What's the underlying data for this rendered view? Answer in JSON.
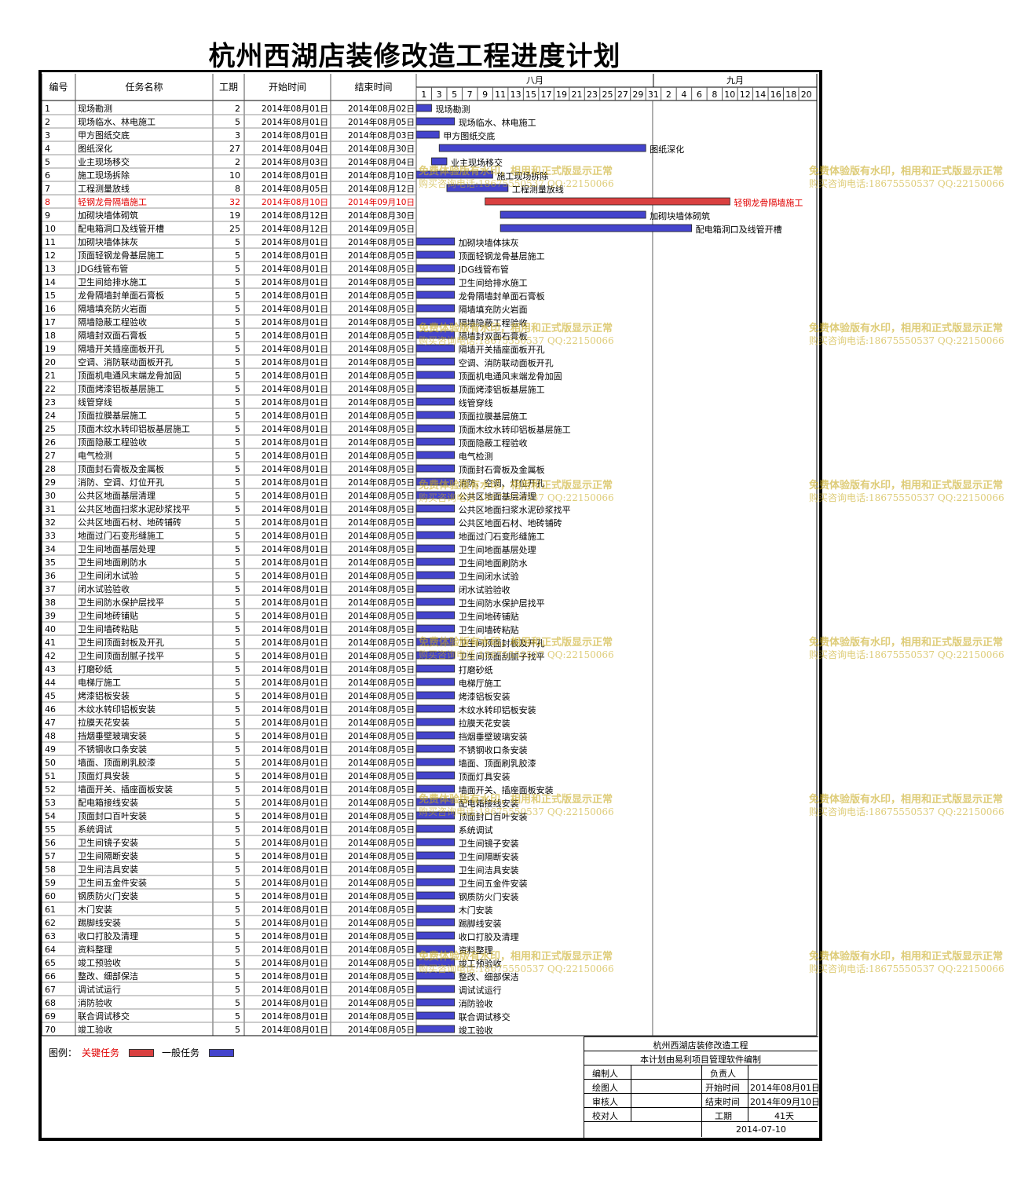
{
  "title": "杭州西湖店装修改造工程进度计划",
  "headers": {
    "id": "编号",
    "name": "任务名称",
    "duration": "工期",
    "start": "开始时间",
    "end": "结束时间"
  },
  "months": [
    "八月",
    "九月"
  ],
  "day_ticks": [
    "1",
    "3",
    "5",
    "7",
    "9",
    "11",
    "13",
    "15",
    "17",
    "19",
    "21",
    "23",
    "25",
    "27",
    "29",
    "31",
    "2",
    "4",
    "6",
    "8",
    "10",
    "12",
    "14",
    "16",
    "18",
    "20"
  ],
  "colors": {
    "critical": "#d94040",
    "general": "#4444cc",
    "critical_text": "#e00000",
    "watermark": "#c8aa1e"
  },
  "chart_data": {
    "type": "gantt",
    "title": "杭州西湖店装修改造工程进度计划",
    "x_axis": {
      "start": "2014-08-01",
      "end": "2014-09-21",
      "months": [
        "八月",
        "九月"
      ]
    },
    "tasks": [
      {
        "id": 1,
        "name": "现场勘测",
        "duration": 2,
        "start": "2014年08月01日",
        "end": "2014年08月02日",
        "critical": false
      },
      {
        "id": 2,
        "name": "现场临水、林电施工",
        "duration": 5,
        "start": "2014年08月01日",
        "end": "2014年08月05日",
        "critical": false
      },
      {
        "id": 3,
        "name": "甲方图纸交底",
        "duration": 3,
        "start": "2014年08月01日",
        "end": "2014年08月03日",
        "critical": false
      },
      {
        "id": 4,
        "name": "图纸深化",
        "duration": 27,
        "start": "2014年08月04日",
        "end": "2014年08月30日",
        "critical": false
      },
      {
        "id": 5,
        "name": "业主现场移交",
        "duration": 2,
        "start": "2014年08月03日",
        "end": "2014年08月04日",
        "critical": false
      },
      {
        "id": 6,
        "name": "施工现场拆除",
        "duration": 10,
        "start": "2014年08月01日",
        "end": "2014年08月10日",
        "critical": false
      },
      {
        "id": 7,
        "name": "工程测量放线",
        "duration": 8,
        "start": "2014年08月05日",
        "end": "2014年08月12日",
        "critical": false
      },
      {
        "id": 8,
        "name": "轻钢龙骨隔墙施工",
        "duration": 32,
        "start": "2014年08月10日",
        "end": "2014年09月10日",
        "critical": true
      },
      {
        "id": 9,
        "name": "加砌块墙体砌筑",
        "duration": 19,
        "start": "2014年08月12日",
        "end": "2014年08月30日",
        "critical": false
      },
      {
        "id": 10,
        "name": "配电箱洞口及线管开槽",
        "duration": 25,
        "start": "2014年08月12日",
        "end": "2014年09月05日",
        "critical": false
      },
      {
        "id": 11,
        "name": "加砌块墙体抹灰",
        "duration": 5,
        "start": "2014年08月01日",
        "end": "2014年08月05日",
        "critical": false
      },
      {
        "id": 12,
        "name": "顶面轻钢龙骨基层施工",
        "duration": 5,
        "start": "2014年08月01日",
        "end": "2014年08月05日",
        "critical": false
      },
      {
        "id": 13,
        "name": "JDG线管布管",
        "duration": 5,
        "start": "2014年08月01日",
        "end": "2014年08月05日",
        "critical": false
      },
      {
        "id": 14,
        "name": "卫生间给排水施工",
        "duration": 5,
        "start": "2014年08月01日",
        "end": "2014年08月05日",
        "critical": false
      },
      {
        "id": 15,
        "name": "龙骨隔墙封单面石膏板",
        "duration": 5,
        "start": "2014年08月01日",
        "end": "2014年08月05日",
        "critical": false
      },
      {
        "id": 16,
        "name": "隔墙填充防火岩面",
        "duration": 5,
        "start": "2014年08月01日",
        "end": "2014年08月05日",
        "critical": false
      },
      {
        "id": 17,
        "name": "隔墙隐蔽工程验收",
        "duration": 5,
        "start": "2014年08月01日",
        "end": "2014年08月05日",
        "critical": false
      },
      {
        "id": 18,
        "name": "隔墙封双面石膏板",
        "duration": 5,
        "start": "2014年08月01日",
        "end": "2014年08月05日",
        "critical": false
      },
      {
        "id": 19,
        "name": "隔墙开关插座面板开孔",
        "duration": 5,
        "start": "2014年08月01日",
        "end": "2014年08月05日",
        "critical": false
      },
      {
        "id": 20,
        "name": "空调、消防联动面板开孔",
        "duration": 5,
        "start": "2014年08月01日",
        "end": "2014年08月05日",
        "critical": false
      },
      {
        "id": 21,
        "name": "顶面机电通风末端龙骨加固",
        "duration": 5,
        "start": "2014年08月01日",
        "end": "2014年08月05日",
        "critical": false
      },
      {
        "id": 22,
        "name": "顶面烤漆铝板基层施工",
        "duration": 5,
        "start": "2014年08月01日",
        "end": "2014年08月05日",
        "critical": false
      },
      {
        "id": 23,
        "name": "线管穿线",
        "duration": 5,
        "start": "2014年08月01日",
        "end": "2014年08月05日",
        "critical": false
      },
      {
        "id": 24,
        "name": "顶面拉膜基层施工",
        "duration": 5,
        "start": "2014年08月01日",
        "end": "2014年08月05日",
        "critical": false
      },
      {
        "id": 25,
        "name": "顶面木纹水转印铝板基层施工",
        "duration": 5,
        "start": "2014年08月01日",
        "end": "2014年08月05日",
        "critical": false
      },
      {
        "id": 26,
        "name": "顶面隐蔽工程验收",
        "duration": 5,
        "start": "2014年08月01日",
        "end": "2014年08月05日",
        "critical": false
      },
      {
        "id": 27,
        "name": "电气检测",
        "duration": 5,
        "start": "2014年08月01日",
        "end": "2014年08月05日",
        "critical": false
      },
      {
        "id": 28,
        "name": "顶面封石膏板及金属板",
        "duration": 5,
        "start": "2014年08月01日",
        "end": "2014年08月05日",
        "critical": false
      },
      {
        "id": 29,
        "name": "消防、空调、灯位开孔",
        "duration": 5,
        "start": "2014年08月01日",
        "end": "2014年08月05日",
        "critical": false
      },
      {
        "id": 30,
        "name": "公共区地面基层清理",
        "duration": 5,
        "start": "2014年08月01日",
        "end": "2014年08月05日",
        "critical": false
      },
      {
        "id": 31,
        "name": "公共区地面扫浆水泥砂浆找平",
        "duration": 5,
        "start": "2014年08月01日",
        "end": "2014年08月05日",
        "critical": false
      },
      {
        "id": 32,
        "name": "公共区地面石材、地砖铺砖",
        "duration": 5,
        "start": "2014年08月01日",
        "end": "2014年08月05日",
        "critical": false
      },
      {
        "id": 33,
        "name": "地面过门石变形缝施工",
        "duration": 5,
        "start": "2014年08月01日",
        "end": "2014年08月05日",
        "critical": false
      },
      {
        "id": 34,
        "name": "卫生间地面基层处理",
        "duration": 5,
        "start": "2014年08月01日",
        "end": "2014年08月05日",
        "critical": false
      },
      {
        "id": 35,
        "name": "卫生间地面刷防水",
        "duration": 5,
        "start": "2014年08月01日",
        "end": "2014年08月05日",
        "critical": false
      },
      {
        "id": 36,
        "name": "卫生间闭水试验",
        "duration": 5,
        "start": "2014年08月01日",
        "end": "2014年08月05日",
        "critical": false
      },
      {
        "id": 37,
        "name": "闭水试验验收",
        "duration": 5,
        "start": "2014年08月01日",
        "end": "2014年08月05日",
        "critical": false
      },
      {
        "id": 38,
        "name": "卫生间防水保护层找平",
        "duration": 5,
        "start": "2014年08月01日",
        "end": "2014年08月05日",
        "critical": false
      },
      {
        "id": 39,
        "name": "卫生间地砖铺贴",
        "duration": 5,
        "start": "2014年08月01日",
        "end": "2014年08月05日",
        "critical": false
      },
      {
        "id": 40,
        "name": "卫生间墙砖粘贴",
        "duration": 5,
        "start": "2014年08月01日",
        "end": "2014年08月05日",
        "critical": false
      },
      {
        "id": 41,
        "name": "卫生间顶面封板及开孔",
        "duration": 5,
        "start": "2014年08月01日",
        "end": "2014年08月05日",
        "critical": false
      },
      {
        "id": 42,
        "name": "卫生间顶面刮腻子找平",
        "duration": 5,
        "start": "2014年08月01日",
        "end": "2014年08月05日",
        "critical": false
      },
      {
        "id": 43,
        "name": "打磨砂纸",
        "duration": 5,
        "start": "2014年08月01日",
        "end": "2014年08月05日",
        "critical": false
      },
      {
        "id": 44,
        "name": "电梯厅施工",
        "duration": 5,
        "start": "2014年08月01日",
        "end": "2014年08月05日",
        "critical": false
      },
      {
        "id": 45,
        "name": "烤漆铝板安装",
        "duration": 5,
        "start": "2014年08月01日",
        "end": "2014年08月05日",
        "critical": false
      },
      {
        "id": 46,
        "name": "木纹水转印铝板安装",
        "duration": 5,
        "start": "2014年08月01日",
        "end": "2014年08月05日",
        "critical": false
      },
      {
        "id": 47,
        "name": "拉膜天花安装",
        "duration": 5,
        "start": "2014年08月01日",
        "end": "2014年08月05日",
        "critical": false
      },
      {
        "id": 48,
        "name": "挡烟垂壁玻璃安装",
        "duration": 5,
        "start": "2014年08月01日",
        "end": "2014年08月05日",
        "critical": false
      },
      {
        "id": 49,
        "name": "不锈钢收口条安装",
        "duration": 5,
        "start": "2014年08月01日",
        "end": "2014年08月05日",
        "critical": false
      },
      {
        "id": 50,
        "name": "墙面、顶面刷乳胶漆",
        "duration": 5,
        "start": "2014年08月01日",
        "end": "2014年08月05日",
        "critical": false
      },
      {
        "id": 51,
        "name": "顶面灯具安装",
        "duration": 5,
        "start": "2014年08月01日",
        "end": "2014年08月05日",
        "critical": false
      },
      {
        "id": 52,
        "name": "墙面开关、插座面板安装",
        "duration": 5,
        "start": "2014年08月01日",
        "end": "2014年08月05日",
        "critical": false
      },
      {
        "id": 53,
        "name": "配电箱接线安装",
        "duration": 5,
        "start": "2014年08月01日",
        "end": "2014年08月05日",
        "critical": false
      },
      {
        "id": 54,
        "name": "顶面封口百叶安装",
        "duration": 5,
        "start": "2014年08月01日",
        "end": "2014年08月05日",
        "critical": false
      },
      {
        "id": 55,
        "name": "系统调试",
        "duration": 5,
        "start": "2014年08月01日",
        "end": "2014年08月05日",
        "critical": false
      },
      {
        "id": 56,
        "name": "卫生间镜子安装",
        "duration": 5,
        "start": "2014年08月01日",
        "end": "2014年08月05日",
        "critical": false
      },
      {
        "id": 57,
        "name": "卫生间隔断安装",
        "duration": 5,
        "start": "2014年08月01日",
        "end": "2014年08月05日",
        "critical": false
      },
      {
        "id": 58,
        "name": "卫生间洁具安装",
        "duration": 5,
        "start": "2014年08月01日",
        "end": "2014年08月05日",
        "critical": false
      },
      {
        "id": 59,
        "name": "卫生间五金件安装",
        "duration": 5,
        "start": "2014年08月01日",
        "end": "2014年08月05日",
        "critical": false
      },
      {
        "id": 60,
        "name": "钢质防火门安装",
        "duration": 5,
        "start": "2014年08月01日",
        "end": "2014年08月05日",
        "critical": false
      },
      {
        "id": 61,
        "name": "木门安装",
        "duration": 5,
        "start": "2014年08月01日",
        "end": "2014年08月05日",
        "critical": false
      },
      {
        "id": 62,
        "name": "踢脚线安装",
        "duration": 5,
        "start": "2014年08月01日",
        "end": "2014年08月05日",
        "critical": false
      },
      {
        "id": 63,
        "name": "收口打胶及清理",
        "duration": 5,
        "start": "2014年08月01日",
        "end": "2014年08月05日",
        "critical": false
      },
      {
        "id": 64,
        "name": "资料整理",
        "duration": 5,
        "start": "2014年08月01日",
        "end": "2014年08月05日",
        "critical": false
      },
      {
        "id": 65,
        "name": "竣工预验收",
        "duration": 5,
        "start": "2014年08月01日",
        "end": "2014年08月05日",
        "critical": false
      },
      {
        "id": 66,
        "name": "整改、细部保洁",
        "duration": 5,
        "start": "2014年08月01日",
        "end": "2014年08月05日",
        "critical": false
      },
      {
        "id": 67,
        "name": "调试试运行",
        "duration": 5,
        "start": "2014年08月01日",
        "end": "2014年08月05日",
        "critical": false
      },
      {
        "id": 68,
        "name": "消防验收",
        "duration": 5,
        "start": "2014年08月01日",
        "end": "2014年08月05日",
        "critical": false
      },
      {
        "id": 69,
        "name": "联合调试移交",
        "duration": 5,
        "start": "2014年08月01日",
        "end": "2014年08月05日",
        "critical": false
      },
      {
        "id": 70,
        "name": "竣工验收",
        "duration": 5,
        "start": "2014年08月01日",
        "end": "2014年08月05日",
        "critical": false
      }
    ]
  },
  "legend": {
    "label": "图例：",
    "critical": "关键任务",
    "general": "一般任务"
  },
  "info": {
    "project": "杭州西湖店装修改造工程",
    "software": "本计划由易利项目管理软件编制",
    "prepared_by": "编制人",
    "drawn_by": "绘图人",
    "reviewed_by": "审核人",
    "checked_by": "校对人",
    "owner": "负责人",
    "start_label": "开始时间",
    "start_value": "2014年08月01日",
    "end_label": "结束时间",
    "end_value": "2014年09月10日",
    "duration_label": "工期",
    "duration_value": "41天",
    "date": "2014-07-10"
  },
  "watermark": {
    "line1": "免费体验版有水印，相用和正式版显示正常",
    "line2": "购买咨询电话:18675550537 QQ:22150066"
  }
}
